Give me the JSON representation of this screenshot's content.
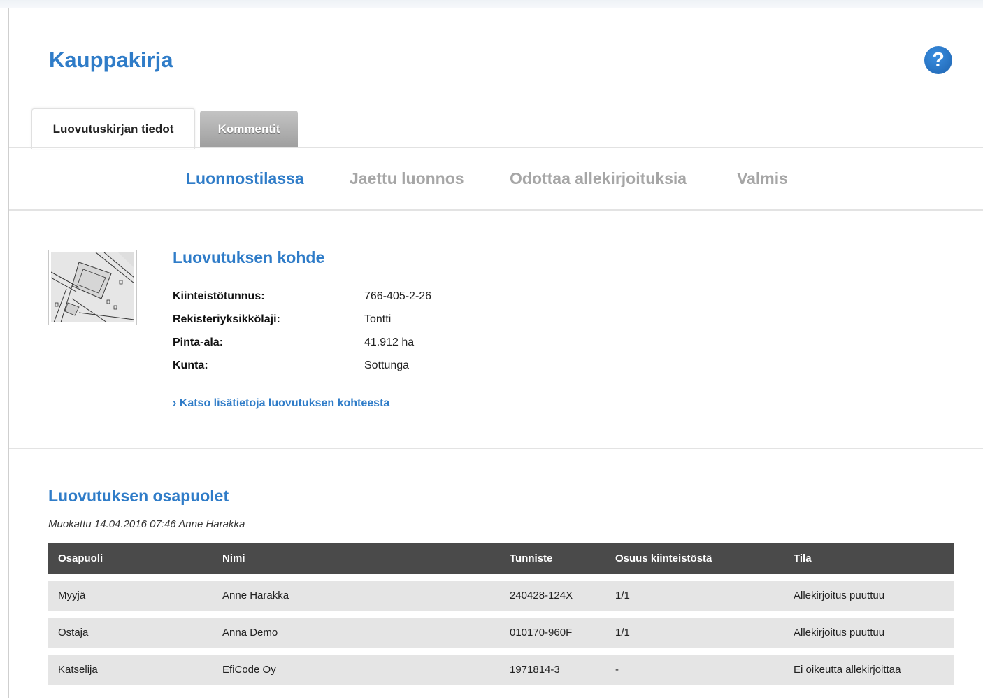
{
  "page": {
    "title": "Kauppakirja",
    "help_icon": "question-mark-icon"
  },
  "tabs": [
    {
      "label": "Luovutuskirjan tiedot",
      "active": true
    },
    {
      "label": "Kommentit",
      "active": false
    }
  ],
  "steps": [
    {
      "label": "Luonnostilassa",
      "active": true
    },
    {
      "label": "Jaettu luonnos",
      "active": false
    },
    {
      "label": "Odottaa allekirjoituksia",
      "active": false
    },
    {
      "label": "Valmis",
      "active": false
    }
  ],
  "property": {
    "title": "Luovutuksen kohde",
    "map_thumbnail": "map-thumbnail",
    "fields": [
      {
        "label": "Kiinteistötunnus:",
        "value": "766-405-2-26"
      },
      {
        "label": "Rekisteriyksikkölaji:",
        "value": "Tontti"
      },
      {
        "label": "Pinta-ala:",
        "value": "41.912 ha"
      },
      {
        "label": "Kunta:",
        "value": "Sottunga"
      }
    ],
    "more_link": "› Katso lisätietoja luovutuksen kohteesta"
  },
  "parties": {
    "title": "Luovutuksen osapuolet",
    "modified": "Muokattu 14.04.2016 07:46 Anne Harakka",
    "columns": [
      "Osapuoli",
      "Nimi",
      "Tunniste",
      "Osuus kiinteistöstä",
      "Tila"
    ],
    "rows": [
      [
        "Myyjä",
        "Anne Harakka",
        "240428-124X",
        "1/1",
        "Allekirjoitus puuttuu"
      ],
      [
        "Ostaja",
        "Anna Demo",
        "010170-960F",
        "1/1",
        "Allekirjoitus puuttuu"
      ],
      [
        "Katselija",
        "EfiCode Oy",
        "1971814-3",
        "-",
        "Ei oikeutta allekirjoittaa"
      ]
    ]
  },
  "colors": {
    "accent": "#2f7cc8",
    "inactive_step": "#a6a6a6",
    "table_header": "#4a4a4a",
    "table_row": "#e5e5e5"
  }
}
